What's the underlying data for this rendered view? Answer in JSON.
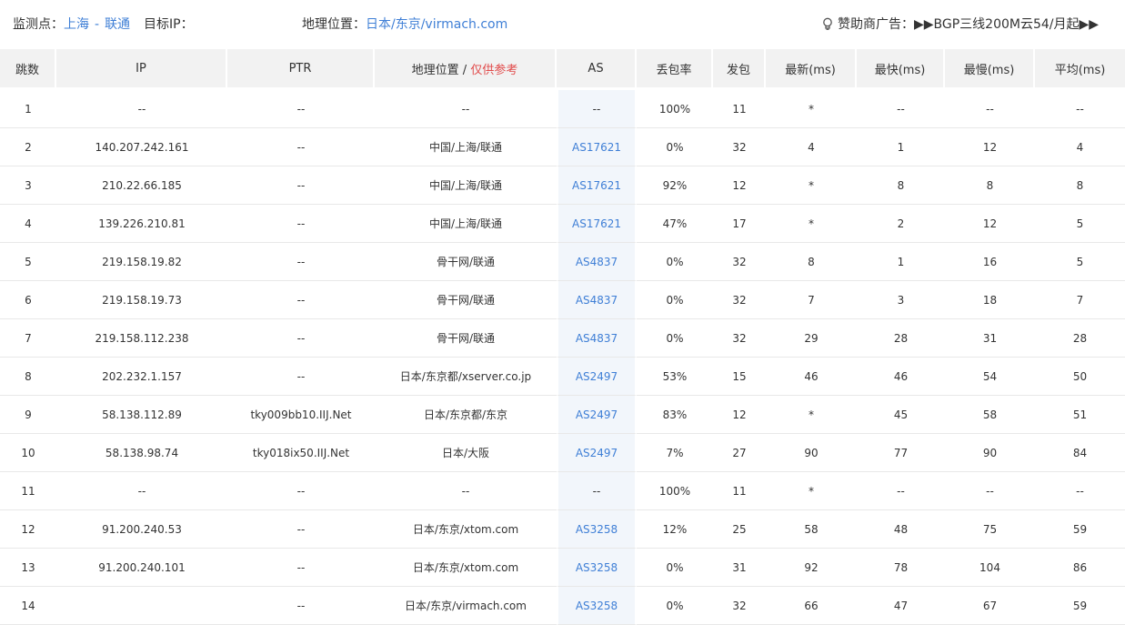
{
  "header": {
    "monitor_label": "监测点：",
    "monitor_city": "上海",
    "monitor_sep": "-",
    "monitor_isp": "联通",
    "target_ip_label": "目标IP：",
    "geo_label": "地理位置：",
    "geo_value": "日本/东京/virmach.com",
    "sponsor_label": "赞助商广告：",
    "sponsor_text": "▶▶BGP三线200M云54/月起▶▶",
    "sponsor_icon": "lightbulb-icon"
  },
  "columns": {
    "hop": "跳数",
    "ip": "IP",
    "ptr": "PTR",
    "geo": "地理位置 / ",
    "geo_hint": "仅供参考",
    "as": "AS",
    "loss": "丢包率",
    "sent": "发包",
    "last": "最新(ms)",
    "best": "最快(ms)",
    "worst": "最慢(ms)",
    "avg": "平均(ms)"
  },
  "rows": [
    {
      "hop": "1",
      "ip": "--",
      "ptr": "--",
      "geo": "--",
      "as": "--",
      "loss": "100%",
      "sent": "11",
      "last": "*",
      "best": "--",
      "worst": "--",
      "avg": "--"
    },
    {
      "hop": "2",
      "ip": "140.207.242.161",
      "ptr": "--",
      "geo": "中国/上海/联通",
      "as": "AS17621",
      "loss": "0%",
      "sent": "32",
      "last": "4",
      "best": "1",
      "worst": "12",
      "avg": "4"
    },
    {
      "hop": "3",
      "ip": "210.22.66.185",
      "ptr": "--",
      "geo": "中国/上海/联通",
      "as": "AS17621",
      "loss": "92%",
      "sent": "12",
      "last": "*",
      "best": "8",
      "worst": "8",
      "avg": "8"
    },
    {
      "hop": "4",
      "ip": "139.226.210.81",
      "ptr": "--",
      "geo": "中国/上海/联通",
      "as": "AS17621",
      "loss": "47%",
      "sent": "17",
      "last": "*",
      "best": "2",
      "worst": "12",
      "avg": "5"
    },
    {
      "hop": "5",
      "ip": "219.158.19.82",
      "ptr": "--",
      "geo": "骨干网/联通",
      "as": "AS4837",
      "loss": "0%",
      "sent": "32",
      "last": "8",
      "best": "1",
      "worst": "16",
      "avg": "5"
    },
    {
      "hop": "6",
      "ip": "219.158.19.73",
      "ptr": "--",
      "geo": "骨干网/联通",
      "as": "AS4837",
      "loss": "0%",
      "sent": "32",
      "last": "7",
      "best": "3",
      "worst": "18",
      "avg": "7"
    },
    {
      "hop": "7",
      "ip": "219.158.112.238",
      "ptr": "--",
      "geo": "骨干网/联通",
      "as": "AS4837",
      "loss": "0%",
      "sent": "32",
      "last": "29",
      "best": "28",
      "worst": "31",
      "avg": "28"
    },
    {
      "hop": "8",
      "ip": "202.232.1.157",
      "ptr": "--",
      "geo": "日本/东京都/xserver.co.jp",
      "as": "AS2497",
      "loss": "53%",
      "sent": "15",
      "last": "46",
      "best": "46",
      "worst": "54",
      "avg": "50"
    },
    {
      "hop": "9",
      "ip": "58.138.112.89",
      "ptr": "tky009bb10.IIJ.Net",
      "geo": "日本/东京都/东京",
      "as": "AS2497",
      "loss": "83%",
      "sent": "12",
      "last": "*",
      "best": "45",
      "worst": "58",
      "avg": "51"
    },
    {
      "hop": "10",
      "ip": "58.138.98.74",
      "ptr": "tky018ix50.IIJ.Net",
      "geo": "日本/大阪",
      "as": "AS2497",
      "loss": "7%",
      "sent": "27",
      "last": "90",
      "best": "77",
      "worst": "90",
      "avg": "84"
    },
    {
      "hop": "11",
      "ip": "--",
      "ptr": "--",
      "geo": "--",
      "as": "--",
      "loss": "100%",
      "sent": "11",
      "last": "*",
      "best": "--",
      "worst": "--",
      "avg": "--"
    },
    {
      "hop": "12",
      "ip": "91.200.240.53",
      "ptr": "--",
      "geo": "日本/东京/xtom.com",
      "as": "AS3258",
      "loss": "12%",
      "sent": "25",
      "last": "58",
      "best": "48",
      "worst": "75",
      "avg": "59"
    },
    {
      "hop": "13",
      "ip": "91.200.240.101",
      "ptr": "--",
      "geo": "日本/东京/xtom.com",
      "as": "AS3258",
      "loss": "0%",
      "sent": "31",
      "last": "92",
      "best": "78",
      "worst": "104",
      "avg": "86"
    },
    {
      "hop": "14",
      "ip": "",
      "ptr": "--",
      "geo": "日本/东京/virmach.com",
      "as": "AS3258",
      "loss": "0%",
      "sent": "32",
      "last": "66",
      "best": "47",
      "worst": "67",
      "avg": "59"
    }
  ]
}
